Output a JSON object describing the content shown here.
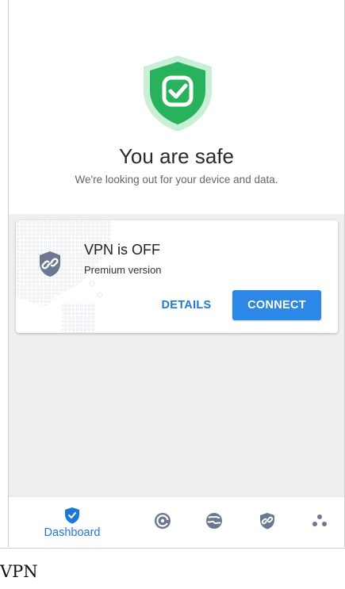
{
  "hero": {
    "title": "You are safe",
    "subtitle": "We're looking out for your device and data.",
    "shield_icon": "shield-check-icon",
    "shield_color": "#22b35a"
  },
  "vpn_card": {
    "status": "VPN is OFF",
    "plan": "Premium version",
    "details_label": "DETAILS",
    "connect_label": "CONNECT",
    "icon": "vpn-link-shield-icon"
  },
  "bottom_nav": {
    "items": [
      {
        "label": "Dashboard",
        "icon": "shield-check-icon",
        "active": true
      },
      {
        "label": "",
        "icon": "speedometer-icon",
        "active": false
      },
      {
        "label": "",
        "icon": "globe-icon",
        "active": false
      },
      {
        "label": "",
        "icon": "vpn-shield-icon",
        "active": false
      },
      {
        "label": "",
        "icon": "more-dots-icon",
        "active": false
      }
    ]
  },
  "caption": "VPN",
  "colors": {
    "accent": "#1e79d6",
    "button_bg": "#2d87e6",
    "safe_green": "#22b35a",
    "content_bg": "#efefef"
  }
}
